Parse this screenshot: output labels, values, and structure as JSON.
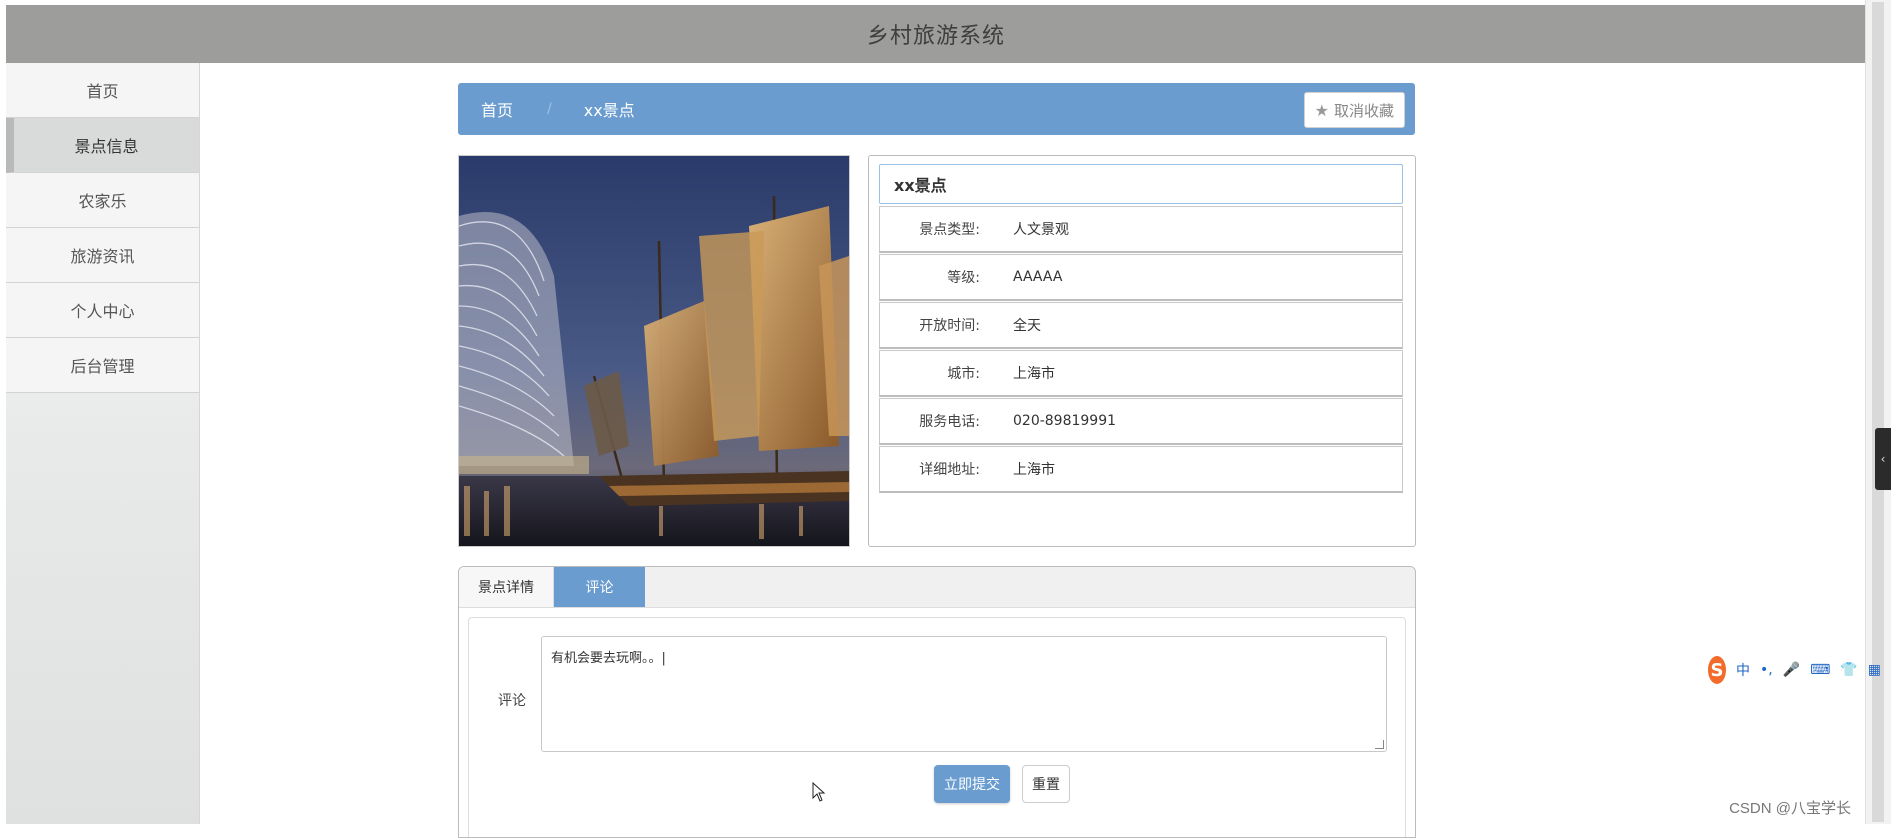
{
  "app": {
    "title": "乡村旅游系统"
  },
  "sidebar": {
    "items": [
      {
        "label": "首页"
      },
      {
        "label": "景点信息",
        "active": true
      },
      {
        "label": "农家乐"
      },
      {
        "label": "旅游资讯"
      },
      {
        "label": "个人中心"
      },
      {
        "label": "后台管理"
      }
    ]
  },
  "breadcrumb": {
    "home": "首页",
    "separator": "/",
    "current": "xx景点",
    "favorite_button": "取消收藏",
    "favorite_icon": "star-icon"
  },
  "detail": {
    "name": "xx景点",
    "fields": [
      {
        "label": "景点类型:",
        "value": "人文景观"
      },
      {
        "label": "等级:",
        "value": "AAAAA"
      },
      {
        "label": "开放时间:",
        "value": "全天"
      },
      {
        "label": "城市:",
        "value": "上海市"
      },
      {
        "label": "服务电话:",
        "value": "020-89819991"
      },
      {
        "label": "详细地址:",
        "value": "上海市"
      }
    ]
  },
  "tabs": [
    {
      "label": "景点详情",
      "active": false
    },
    {
      "label": "评论",
      "active": true
    }
  ],
  "comment_form": {
    "label": "评论",
    "value": "有机会要去玩啊。。|",
    "submit_label": "立即提交",
    "reset_label": "重置"
  },
  "ime": {
    "logo": "S",
    "items": [
      "中",
      "•,",
      "🎤",
      "⌨",
      "👕",
      "▦"
    ]
  },
  "watermark": "CSDN @八宝学长",
  "colors": {
    "header": "#9d9e9c",
    "accent": "#6a9ccf"
  }
}
